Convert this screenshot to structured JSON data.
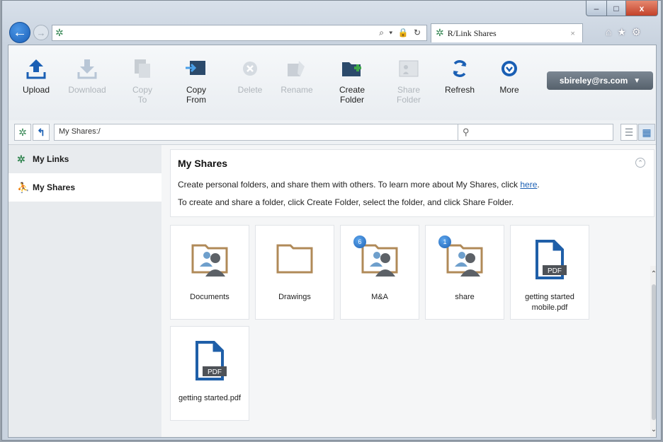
{
  "browser": {
    "tab_title": "R/Link Shares",
    "tab_close": "×",
    "address_tools": "⌕ ▾ 🔒 ↻",
    "window_min": "–",
    "window_max": "□",
    "window_close": "x",
    "back_glyph": "←",
    "forward_glyph": "→",
    "tools_glyphs": "⌂★⚙"
  },
  "toolbar": {
    "buttons": [
      {
        "label": "Upload",
        "icon": "upload-icon",
        "enabled": true
      },
      {
        "label": "Download",
        "icon": "download-icon",
        "enabled": false
      },
      {
        "label": "Copy\nTo",
        "icon": "copy-to-icon",
        "enabled": false
      },
      {
        "label": "Copy\nFrom",
        "icon": "copy-from-icon",
        "enabled": true
      },
      {
        "label": "Delete",
        "icon": "delete-icon",
        "enabled": false
      },
      {
        "label": "Rename",
        "icon": "rename-icon",
        "enabled": false
      },
      {
        "label": "Create\nFolder",
        "icon": "create-folder-icon",
        "enabled": true
      },
      {
        "label": "Share\nFolder",
        "icon": "share-folder-icon",
        "enabled": false
      },
      {
        "label": "Refresh",
        "icon": "refresh-icon",
        "enabled": true
      },
      {
        "label": "More",
        "icon": "more-icon",
        "enabled": true
      }
    ],
    "user": "sbireley@rs.com"
  },
  "pathbar": {
    "path": "My Shares:/",
    "search_placeholder": ""
  },
  "sidebar": {
    "items": [
      {
        "label": "My Links",
        "icon": "links-icon",
        "selected": false
      },
      {
        "label": "My Shares",
        "icon": "shares-icon",
        "selected": true
      }
    ]
  },
  "info": {
    "title": "My Shares",
    "line1_text": "Create personal folders, and share them with others. To learn more about My Shares, click ",
    "line1_link": "here",
    "line1_end": ".",
    "line2": "To create and share a folder, click Create Folder, select the folder, and click Share Folder."
  },
  "items": [
    {
      "label": "Documents",
      "kind": "shared-folder",
      "badge": ""
    },
    {
      "label": "Drawings",
      "kind": "folder",
      "badge": ""
    },
    {
      "label": "M&A",
      "kind": "shared-folder",
      "badge": "6"
    },
    {
      "label": "share",
      "kind": "shared-folder",
      "badge": "1"
    },
    {
      "label": "getting started mobile.pdf",
      "kind": "pdf",
      "badge": ""
    },
    {
      "label": "getting started.pdf",
      "kind": "pdf",
      "badge": ""
    }
  ],
  "pdf_tag": "PDF",
  "colors": {
    "accent": "#1a5fb4",
    "folder": "#b08a58",
    "user_button": "#6b7783"
  }
}
